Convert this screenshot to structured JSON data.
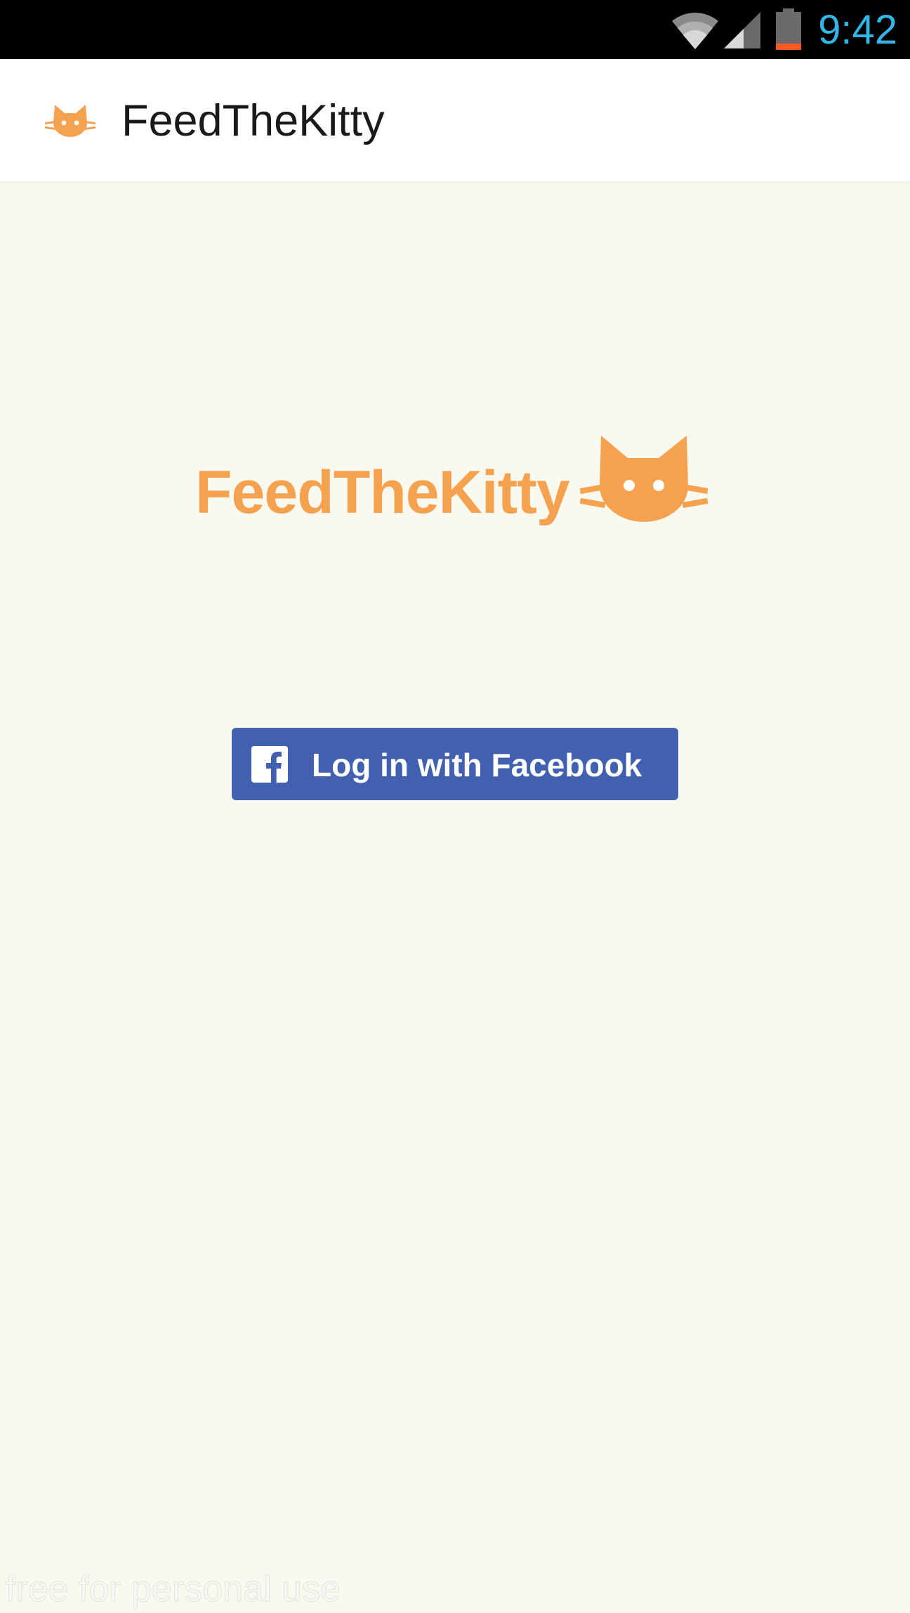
{
  "status_bar": {
    "time": "9:42",
    "icons": [
      "wifi-icon",
      "signal-icon",
      "battery-icon"
    ],
    "clock_color": "#33b5e5",
    "battery_level": 0.15
  },
  "app_bar": {
    "icon": "cat-icon",
    "title": "FeedTheKitty"
  },
  "logo": {
    "text": "FeedTheKitty",
    "icon": "cat-icon",
    "color": "#f4a24f"
  },
  "login": {
    "button_label": "Log in with Facebook",
    "icon": "facebook-icon",
    "color": "#4160b0"
  },
  "watermark": {
    "text": "free for personal use"
  },
  "colors": {
    "background": "#faf9ef",
    "accent": "#f4a24f"
  }
}
